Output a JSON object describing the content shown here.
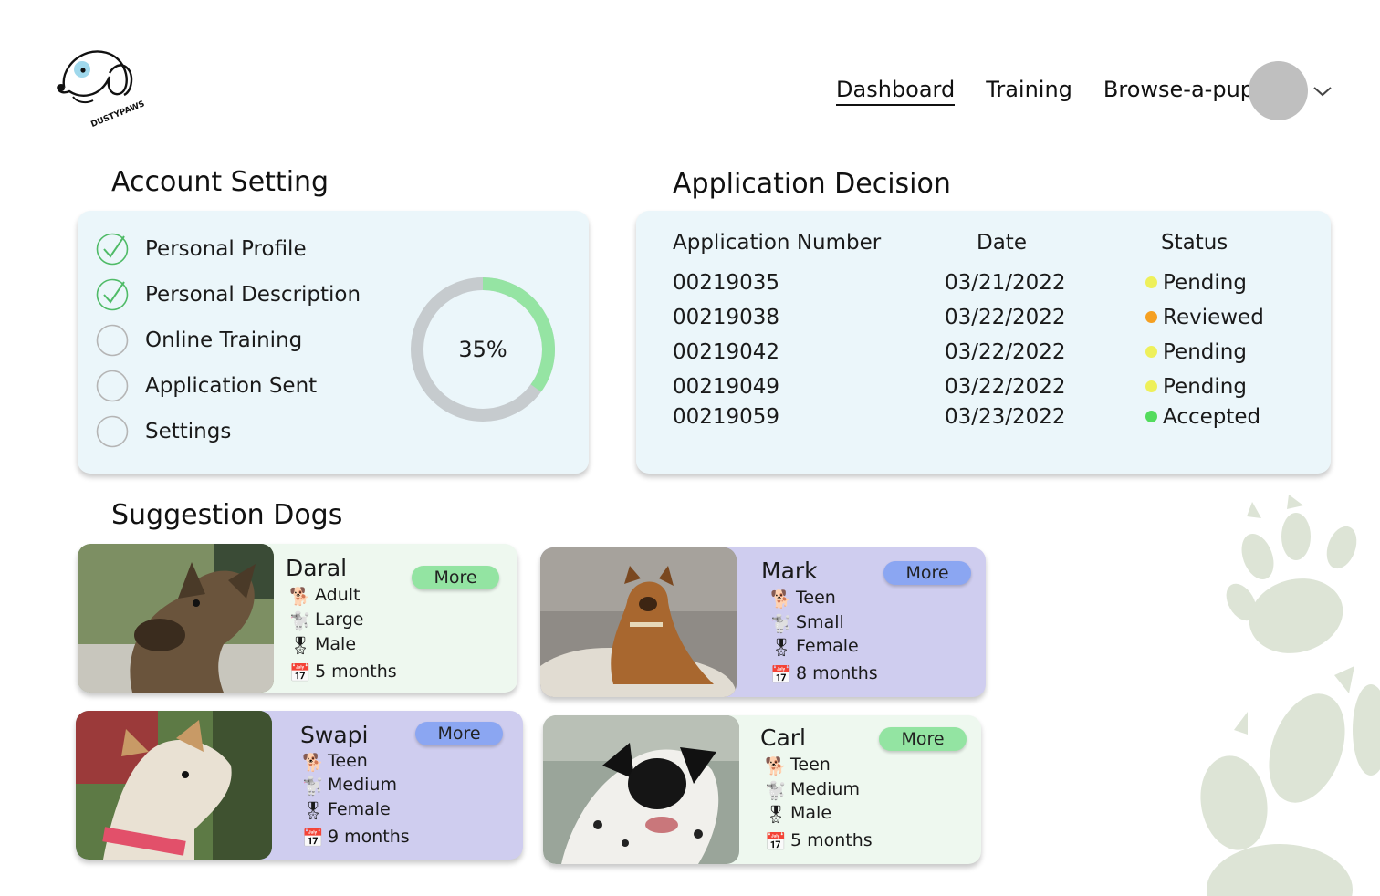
{
  "brand": {
    "logo_text": "DUSTYPAWS"
  },
  "nav": {
    "links": [
      {
        "label": "Dashboard",
        "active": true
      },
      {
        "label": "Training",
        "active": false
      },
      {
        "label": "Browse-a-pup",
        "active": false
      }
    ]
  },
  "account": {
    "title": "Account Setting",
    "items": [
      {
        "label": "Personal Profile",
        "done": true
      },
      {
        "label": "Personal Description",
        "done": true
      },
      {
        "label": "Online Training",
        "done": false
      },
      {
        "label": "Application Sent",
        "done": false
      },
      {
        "label": "Settings",
        "done": false
      }
    ],
    "progress_label": "35%",
    "progress_value": 0.35,
    "progress_color": "#95e4a3",
    "track_color": "#c6cbce"
  },
  "applications": {
    "title": "Application Decision",
    "headers": {
      "number": "Application Number",
      "date": "Date",
      "status": "Status"
    },
    "rows": [
      {
        "number": "00219035",
        "date": "03/21/2022",
        "status": "Pending",
        "color": "#eef05a"
      },
      {
        "number": "00219038",
        "date": "03/22/2022",
        "status": "Reviewed",
        "color": "#f5a021"
      },
      {
        "number": "00219042",
        "date": "03/22/2022",
        "status": "Pending",
        "color": "#eef05a"
      },
      {
        "number": "00219049",
        "date": "03/22/2022",
        "status": "Pending",
        "color": "#eef05a"
      },
      {
        "number": "00219059",
        "date": "03/23/2022",
        "status": "Accepted",
        "color": "#53dc5d"
      }
    ]
  },
  "dogs": {
    "title": "Suggestion Dogs",
    "more_label": "More",
    "items": [
      {
        "name": "Daral",
        "age": "Adult",
        "size": "Large",
        "gender": "Male",
        "time": "5 months",
        "card_color": "#eef8ef",
        "button_color": "#93e4a2"
      },
      {
        "name": "Mark",
        "age": "Teen",
        "size": "Small",
        "gender": "Female",
        "time": "8 months",
        "card_color": "#cfcdef",
        "button_color": "#8ba6f2"
      },
      {
        "name": "Swapi",
        "age": "Teen",
        "size": "Medium",
        "gender": "Female",
        "time": "9 months",
        "card_color": "#cfcdef",
        "button_color": "#8ba6f2"
      },
      {
        "name": "Carl",
        "age": "Teen",
        "size": "Medium",
        "gender": "Male",
        "time": "5 months",
        "card_color": "#eef8ef",
        "button_color": "#93e4a2"
      }
    ]
  }
}
